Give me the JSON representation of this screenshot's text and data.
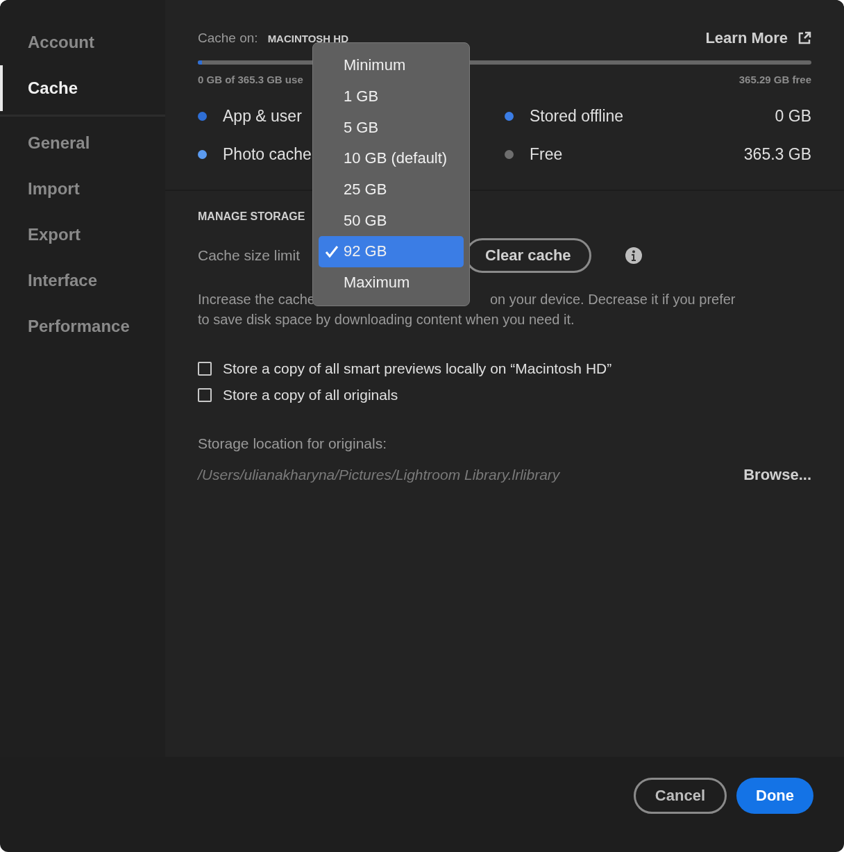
{
  "sidebar": {
    "sections": [
      {
        "items": [
          {
            "label": "Account",
            "selected": false
          },
          {
            "label": "Cache",
            "selected": true
          }
        ]
      },
      {
        "items": [
          {
            "label": "General",
            "selected": false
          },
          {
            "label": "Import",
            "selected": false
          },
          {
            "label": "Export",
            "selected": false
          },
          {
            "label": "Interface",
            "selected": false
          },
          {
            "label": "Performance",
            "selected": false
          }
        ]
      }
    ]
  },
  "storage": {
    "cache_on_label": "Cache on:",
    "drive": "MACINTOSH HD",
    "learn_more": "Learn More",
    "level": 0.004,
    "used": "0 GB of 365.3 GB use",
    "free": "365.29 GB free",
    "legend": [
      {
        "label": "App & user",
        "color": "#2f6fd6"
      },
      {
        "label": "Stored offline",
        "value": "0 GB",
        "color": "#3b7de5"
      },
      {
        "label": "Photo cache",
        "color": "#5b9bf0"
      },
      {
        "label": "Free",
        "value": "365.3 GB",
        "color": "#6e6e6e"
      }
    ]
  },
  "manage": {
    "heading": "MANAGE STORAGE",
    "cache_size_label": "Cache size limit",
    "clear_button": "Clear cache",
    "description": [
      {
        "text": "Increase the cache"
      },
      {
        "text": "on your device. Decrease it if you prefer"
      },
      {
        "text": "to save disk space by downloading content when you need it."
      }
    ],
    "checkboxes": [
      {
        "label": "Store a copy of all smart previews locally on “Macintosh HD”",
        "checked": false
      },
      {
        "label": "Store a copy of all originals",
        "checked": false
      }
    ],
    "location_label": "Storage location for originals:",
    "location_path": "/Users/ulianakharyna/Pictures/Lightroom Library.lrlibrary",
    "browse": "Browse..."
  },
  "menu": {
    "items": [
      {
        "label": "Minimum",
        "selected": false
      },
      {
        "label": "1 GB",
        "selected": false
      },
      {
        "label": "5 GB",
        "selected": false
      },
      {
        "label": "10 GB (default)",
        "selected": false
      },
      {
        "label": "25 GB",
        "selected": false
      },
      {
        "label": "50 GB",
        "selected": false
      },
      {
        "label": "92 GB",
        "selected": true
      },
      {
        "label": "Maximum",
        "selected": false
      }
    ]
  },
  "footer": {
    "cancel": "Cancel",
    "done": "Done"
  }
}
